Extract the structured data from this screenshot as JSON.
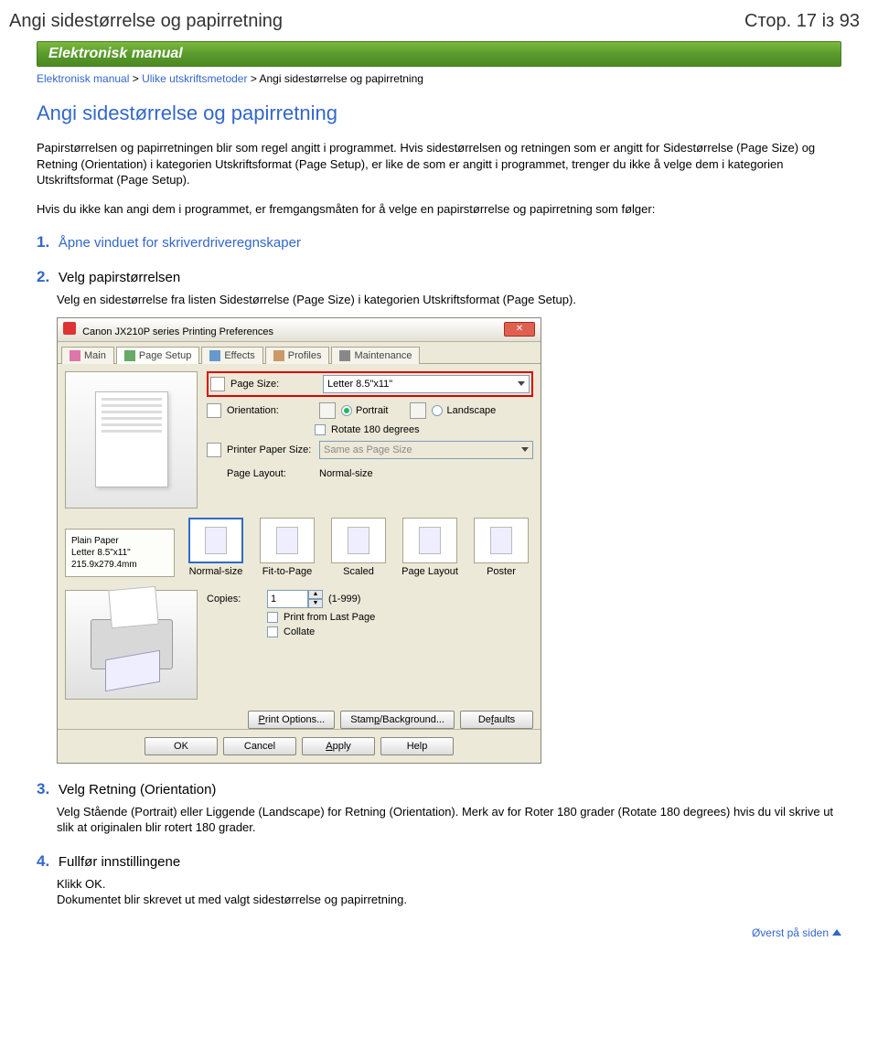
{
  "header": {
    "title": "Angi sidestørrelse og papirretning",
    "page_indicator": "Стор. 17 із 93"
  },
  "banner": "Elektronisk manual",
  "breadcrumb": {
    "root": "Elektronisk manual",
    "mid": "Ulike utskriftsmetoder",
    "current": "Angi sidestørrelse og papirretning",
    "sep": ">"
  },
  "title": "Angi sidestørrelse og papirretning",
  "intro1": "Papirstørrelsen og papirretningen blir som regel angitt i programmet. Hvis sidestørrelsen og retningen som er angitt for Sidestørrelse (Page Size) og Retning (Orientation) i kategorien Utskriftsformat (Page Setup), er like de som er angitt i programmet, trenger du ikke å velge dem i kategorien Utskriftsformat (Page Setup).",
  "intro2": "Hvis du ikke kan angi dem i programmet, er fremgangsmåten for å velge en papirstørrelse og papirretning som følger:",
  "steps": [
    {
      "num": "1.",
      "title": "Åpne vinduet for skriverdriveregnskaper",
      "link": true
    },
    {
      "num": "2.",
      "title": "Velg papirstørrelsen",
      "link": false,
      "body": "Velg en sidestørrelse fra listen Sidestørrelse (Page Size) i kategorien Utskriftsformat (Page Setup)."
    },
    {
      "num": "3.",
      "title": "Velg Retning (Orientation)",
      "link": false,
      "body": "Velg Stående (Portrait) eller Liggende (Landscape) for Retning (Orientation). Merk av for Roter 180 grader (Rotate 180 degrees) hvis du vil skrive ut slik at originalen blir rotert 180 grader."
    },
    {
      "num": "4.",
      "title": "Fullfør innstillingene",
      "link": false,
      "body": "Klikk OK.\nDokumentet blir skrevet ut med valgt sidestørrelse og papirretning."
    }
  ],
  "dialog": {
    "titlebar": "Canon JX210P series Printing Preferences",
    "tabs": [
      "Main",
      "Page Setup",
      "Effects",
      "Profiles",
      "Maintenance"
    ],
    "active_tab": 1,
    "page_size_label": "Page Size:",
    "page_size_value": "Letter 8.5\"x11\"",
    "orientation_label": "Orientation:",
    "orientation_portrait": "Portrait",
    "orientation_landscape": "Landscape",
    "rotate_label": "Rotate 180 degrees",
    "printer_paper_label": "Printer Paper Size:",
    "printer_paper_value": "Same as Page Size",
    "page_layout_label": "Page Layout:",
    "page_layout_value": "Normal-size",
    "layout_opts": [
      "Normal-size",
      "Fit-to-Page",
      "Scaled",
      "Page Layout",
      "Poster"
    ],
    "info_line1": "Plain Paper",
    "info_line2": "Letter 8.5\"x11\" 215.9x279.4mm",
    "copies_label": "Copies:",
    "copies_value": "1",
    "copies_range": "(1-999)",
    "print_last": "Print from Last Page",
    "collate": "Collate",
    "btn_print_options": "Print Options...",
    "btn_stamp": "Stamp/Background...",
    "btn_defaults": "Defaults",
    "btn_ok": "OK",
    "btn_cancel": "Cancel",
    "btn_apply": "Apply",
    "btn_help": "Help"
  },
  "top_link": "Øverst på siden"
}
